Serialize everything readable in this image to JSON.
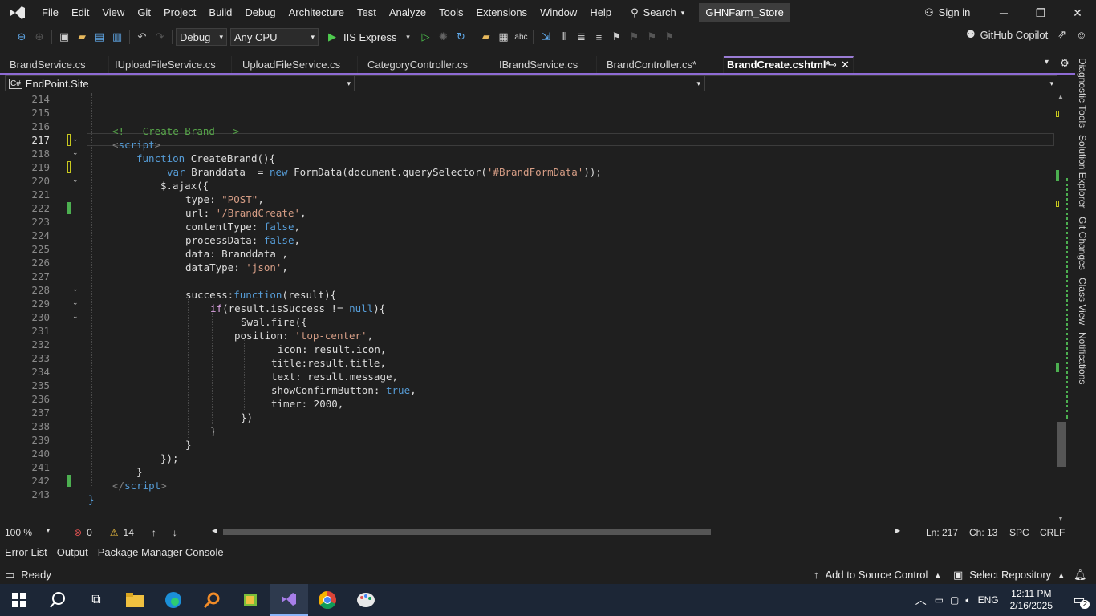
{
  "menu": [
    "File",
    "Edit",
    "View",
    "Git",
    "Project",
    "Build",
    "Debug",
    "Architecture",
    "Test",
    "Analyze",
    "Tools",
    "Extensions",
    "Window",
    "Help"
  ],
  "search_label": "Search",
  "solution_name": "GHNFarm_Store",
  "signin_label": "Sign in",
  "toolbar": {
    "config": "Debug",
    "platform": "Any CPU",
    "run_target": "IIS Express",
    "copilot": "GitHub Copilot"
  },
  "tabs": [
    {
      "label": "BrandService.cs",
      "active": false
    },
    {
      "label": "IUploadFileService.cs",
      "active": false
    },
    {
      "label": "UploadFileService.cs",
      "active": false
    },
    {
      "label": "CategoryController.cs",
      "active": false
    },
    {
      "label": "IBrandService.cs",
      "active": false
    },
    {
      "label": "BrandController.cs*",
      "active": false
    },
    {
      "label": "BrandCreate.cshtml*",
      "active": true
    }
  ],
  "nav": {
    "project": "EndPoint.Site",
    "member": ""
  },
  "right_rail": [
    "Diagnostic Tools",
    "Solution Explorer",
    "Git Changes",
    "Class View",
    "Notifications"
  ],
  "code_lines": [
    {
      "n": "214"
    },
    {
      "n": "215"
    },
    {
      "n": "216"
    },
    {
      "n": "217"
    },
    {
      "n": "218"
    },
    {
      "n": "219"
    },
    {
      "n": "220"
    },
    {
      "n": "221"
    },
    {
      "n": "222"
    },
    {
      "n": "223"
    },
    {
      "n": "224"
    },
    {
      "n": "225"
    },
    {
      "n": "226"
    },
    {
      "n": "227"
    },
    {
      "n": "228"
    },
    {
      "n": "229"
    },
    {
      "n": "230"
    },
    {
      "n": "231"
    },
    {
      "n": "232"
    },
    {
      "n": "233"
    },
    {
      "n": "234"
    },
    {
      "n": "235"
    },
    {
      "n": "236"
    },
    {
      "n": "237"
    },
    {
      "n": "238"
    },
    {
      "n": "239"
    },
    {
      "n": "240"
    },
    {
      "n": "241"
    },
    {
      "n": "242"
    },
    {
      "n": "243"
    }
  ],
  "code": {
    "l216": "<!-- Create Brand -->",
    "l217_open": "<",
    "l217_tag": "script",
    "l217_close": ">",
    "l218_kw": "function",
    "l218_rest": "CreateBrand(){",
    "l219_var": "var",
    "l219_a": "Branddata  = ",
    "l219_new": "new",
    "l219_b": "FormData(document.querySelector(",
    "l219_str": "'#BrandFormData'",
    "l219_c": "));",
    "l220": "$.ajax({",
    "l221_k": "type: ",
    "l221_v": "\"POST\"",
    "l221_e": ",",
    "l222_k": "url: ",
    "l222_v": "'/BrandCreate'",
    "l222_e": ",",
    "l223_k": "contentType: ",
    "l223_v": "false",
    "l223_e": ",",
    "l224_k": "processData: ",
    "l224_v": "false",
    "l224_e": ",",
    "l225": "data: Branddata ,",
    "l226_k": "dataType: ",
    "l226_v": "'json'",
    "l226_e": ",",
    "l228_a": "success:",
    "l228_fn": "function",
    "l228_b": "(result){",
    "l229_if": "if",
    "l229_a": "(result.isSuccess != ",
    "l229_null": "null",
    "l229_b": "){",
    "l230": "Swal.fire({",
    "l231_k": "position: ",
    "l231_v": "'top-center'",
    "l231_e": ",",
    "l232": "icon: result.icon,",
    "l233": "title:result.title,",
    "l234": "text: result.message,",
    "l235_k": "showConfirmButton: ",
    "l235_v": "true",
    "l235_e": ",",
    "l236": "timer: 2000,",
    "l237": "})",
    "l238": "}",
    "l239": "}",
    "l240": "});",
    "l241": "}",
    "l242_open": "</",
    "l242_tag": "script",
    "l242_close": ">",
    "l243": "}"
  },
  "status_line": {
    "zoom": "100 %",
    "errors": "0",
    "warnings": "14",
    "ln": "Ln: 217",
    "ch": "Ch: 13",
    "spc": "SPC",
    "crlf": "CRLF"
  },
  "bottom_tabs": [
    "Error List",
    "Output",
    "Package Manager Console"
  ],
  "statusbar": {
    "ready": "Ready",
    "source_control": "Add to Source Control",
    "repo": "Select Repository"
  },
  "tray": {
    "lang": "ENG",
    "time": "12:11 PM",
    "date": "2/16/2025",
    "notif": "2"
  }
}
